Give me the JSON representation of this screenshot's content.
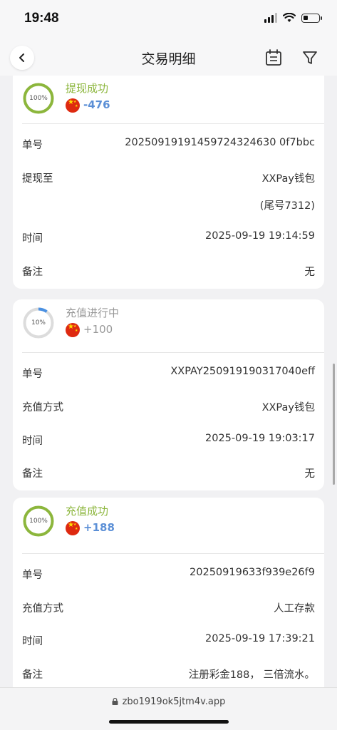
{
  "status_bar": {
    "time": "19:48"
  },
  "header": {
    "title": "交易明细"
  },
  "transactions": [
    {
      "progress": "100%",
      "progress_value": 1.0,
      "status": "提现成功",
      "status_color": "#8cb63c",
      "amount": "-476",
      "rows": [
        {
          "label": "单号",
          "value": "20250919191459724324630 0f7bbc"
        },
        {
          "label": "提现至",
          "value": "XXPay钱包"
        },
        {
          "label": "",
          "value": "(尾号7312)"
        },
        {
          "label": "时间",
          "value": "2025-09-19 19:14:59"
        },
        {
          "label": "备注",
          "value": "无"
        }
      ]
    },
    {
      "progress": "10%",
      "progress_value": 0.1,
      "status": "充值进行中",
      "status_color": "#999999",
      "amount": "+100",
      "rows": [
        {
          "label": "单号",
          "value": "XXPAY250919190317040eff"
        },
        {
          "label": "充值方式",
          "value": "XXPay钱包"
        },
        {
          "label": "时间",
          "value": "2025-09-19 19:03:17"
        },
        {
          "label": "备注",
          "value": "无"
        }
      ]
    },
    {
      "progress": "100%",
      "progress_value": 1.0,
      "status": "充值成功",
      "status_color": "#8cb63c",
      "amount": "+188",
      "rows": [
        {
          "label": "单号",
          "value": "20250919633f939e26f9"
        },
        {
          "label": "充值方式",
          "value": "人工存款"
        },
        {
          "label": "时间",
          "value": "2025-09-19 17:39:21"
        },
        {
          "label": "备注",
          "value": "注册彩金188， 三倍流水。"
        }
      ]
    }
  ],
  "browser": {
    "url": "zbo1919ok5jtm4v.app"
  },
  "colors": {
    "success": "#8cb63c",
    "pending_ring": "#4a90e2",
    "amount": "#5b8fd6"
  }
}
